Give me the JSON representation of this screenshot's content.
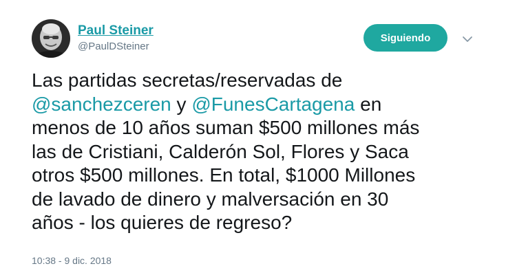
{
  "author": {
    "display_name": "Paul Steiner",
    "handle": "@PaulDSteiner",
    "avatar_icon": "user-avatar-photo"
  },
  "follow_button": {
    "label": "Siguiendo"
  },
  "menu_icon": "chevron-down-icon",
  "tweet": {
    "line1": "Las partidas secretas/reservadas de",
    "mention1": "@sanchezceren",
    "line2_mid": " y ",
    "mention2": "@FunesCartagena",
    "line2_end": " en",
    "line3": "menos de 10 años suman $500 millones más",
    "line4": "las de Cristiani, Calderón Sol, Flores y Saca",
    "line5": "otros $500 millones. En total, $1000 Millones",
    "line6": "de lavado de dinero y malversación en 30",
    "line7": "años - los quieres de regreso?"
  },
  "timestamp": "10:38 - 9 dic. 2018",
  "colors": {
    "link": "#1a9aa6",
    "button": "#1fa8a0",
    "secondary_text": "#657786"
  }
}
